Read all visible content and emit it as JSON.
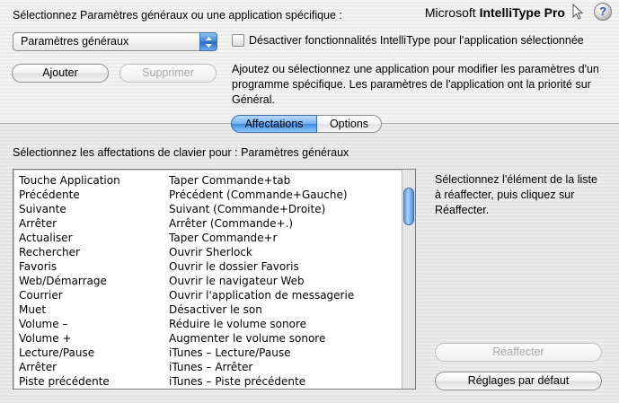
{
  "header": {
    "prompt": "Sélectionnez Paramètres généraux ou une application spécifique :",
    "brand_prefix": "Microsoft ",
    "brand_name": "IntelliType Pro",
    "help_label": "?"
  },
  "app_select": {
    "selected": "Paramètres généraux"
  },
  "disable_checkbox": {
    "label": "Désactiver fonctionnalités IntelliType pour l'application sélectionnée",
    "checked": false
  },
  "buttons": {
    "add": "Ajouter",
    "remove": "Supprimer",
    "reassign": "Réaffecter",
    "defaults": "Réglages par défaut"
  },
  "description": "Ajoutez ou sélectionnez une application pour modifier les paramètres d'un programme spécifique. Les paramètres de l'application ont la priorité sur Général.",
  "tabs": [
    {
      "label": "Affectations",
      "active": true
    },
    {
      "label": "Options",
      "active": false
    }
  ],
  "assignments": {
    "prompt": "Sélectionnez les affectations de clavier pour : Paramètres généraux",
    "instruction": "Sélectionnez l'élément de la liste à réaffecter, puis cliquez sur Réaffecter.",
    "rows": [
      {
        "key": "Touche Application",
        "action": "Taper Commande+tab"
      },
      {
        "key": "Précédente",
        "action": "Précédent (Commande+Gauche)"
      },
      {
        "key": "Suivante",
        "action": "Suivant (Commande+Droite)"
      },
      {
        "key": "Arrêter",
        "action": "Arrêter (Commande+.)"
      },
      {
        "key": "Actualiser",
        "action": "Taper Commande+r"
      },
      {
        "key": "Rechercher",
        "action": "Ouvrir Sherlock"
      },
      {
        "key": "Favoris",
        "action": "Ouvrir le dossier Favoris"
      },
      {
        "key": "Web/Démarrage",
        "action": "Ouvrir le navigateur Web"
      },
      {
        "key": "Courrier",
        "action": "Ouvrir l'application de messagerie"
      },
      {
        "key": "Muet",
        "action": "Désactiver le son"
      },
      {
        "key": "Volume –",
        "action": "Réduire le volume sonore"
      },
      {
        "key": "Volume +",
        "action": "Augmenter le volume sonore"
      },
      {
        "key": "Lecture/Pause",
        "action": "iTunes – Lecture/Pause"
      },
      {
        "key": "Arrêter",
        "action": "iTunes – Arrêter"
      },
      {
        "key": "Piste précédente",
        "action": "iTunes – Piste précédente"
      }
    ]
  },
  "colors": {
    "accent_blue": "#3f8ae0",
    "disabled_text": "#a7a7a7"
  }
}
